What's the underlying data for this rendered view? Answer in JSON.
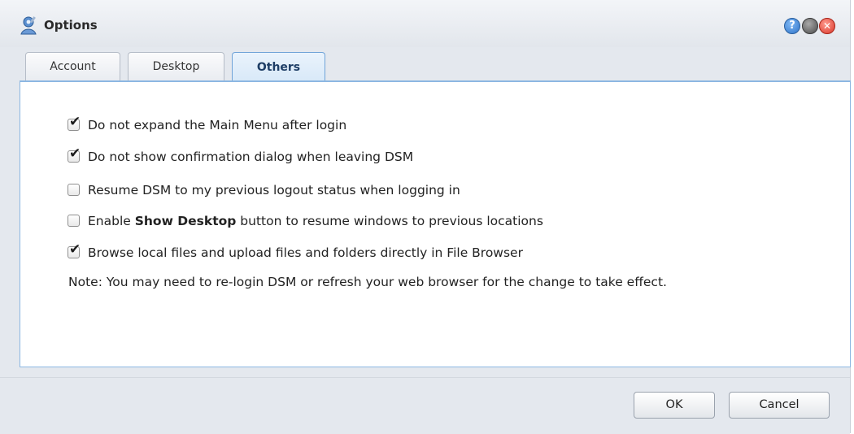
{
  "window": {
    "title": "Options",
    "help_glyph": "?",
    "close_glyph": "✕"
  },
  "tabs": [
    {
      "label": "Account",
      "active": false
    },
    {
      "label": "Desktop",
      "active": false
    },
    {
      "label": "Others",
      "active": true
    }
  ],
  "options": [
    {
      "checked": true,
      "label": "Do not expand the Main Menu after login"
    },
    {
      "checked": true,
      "label": "Do not show confirmation dialog when leaving DSM"
    },
    {
      "checked": false,
      "label": "Resume DSM to my previous logout status when logging in"
    },
    {
      "checked": false,
      "label_prefix": "Enable ",
      "label_bold": "Show Desktop",
      "label_suffix": " button to resume windows to previous locations"
    },
    {
      "checked": true,
      "label": "Browse local files and upload files and folders directly in File Browser"
    }
  ],
  "note": "Note: You may need to re-login DSM or refresh your web browser for the change to take effect.",
  "check_glyph": "✔",
  "buttons": {
    "ok": "OK",
    "cancel": "Cancel"
  },
  "icons": {
    "title": "options-gear-user-icon",
    "help": "help-icon",
    "minimize": "minimize-icon",
    "close": "close-icon"
  },
  "colors": {
    "accent": "#8cb7e2",
    "active_tab_text": "#1e3e66",
    "close": "#d9372a",
    "help": "#2f74c9"
  }
}
